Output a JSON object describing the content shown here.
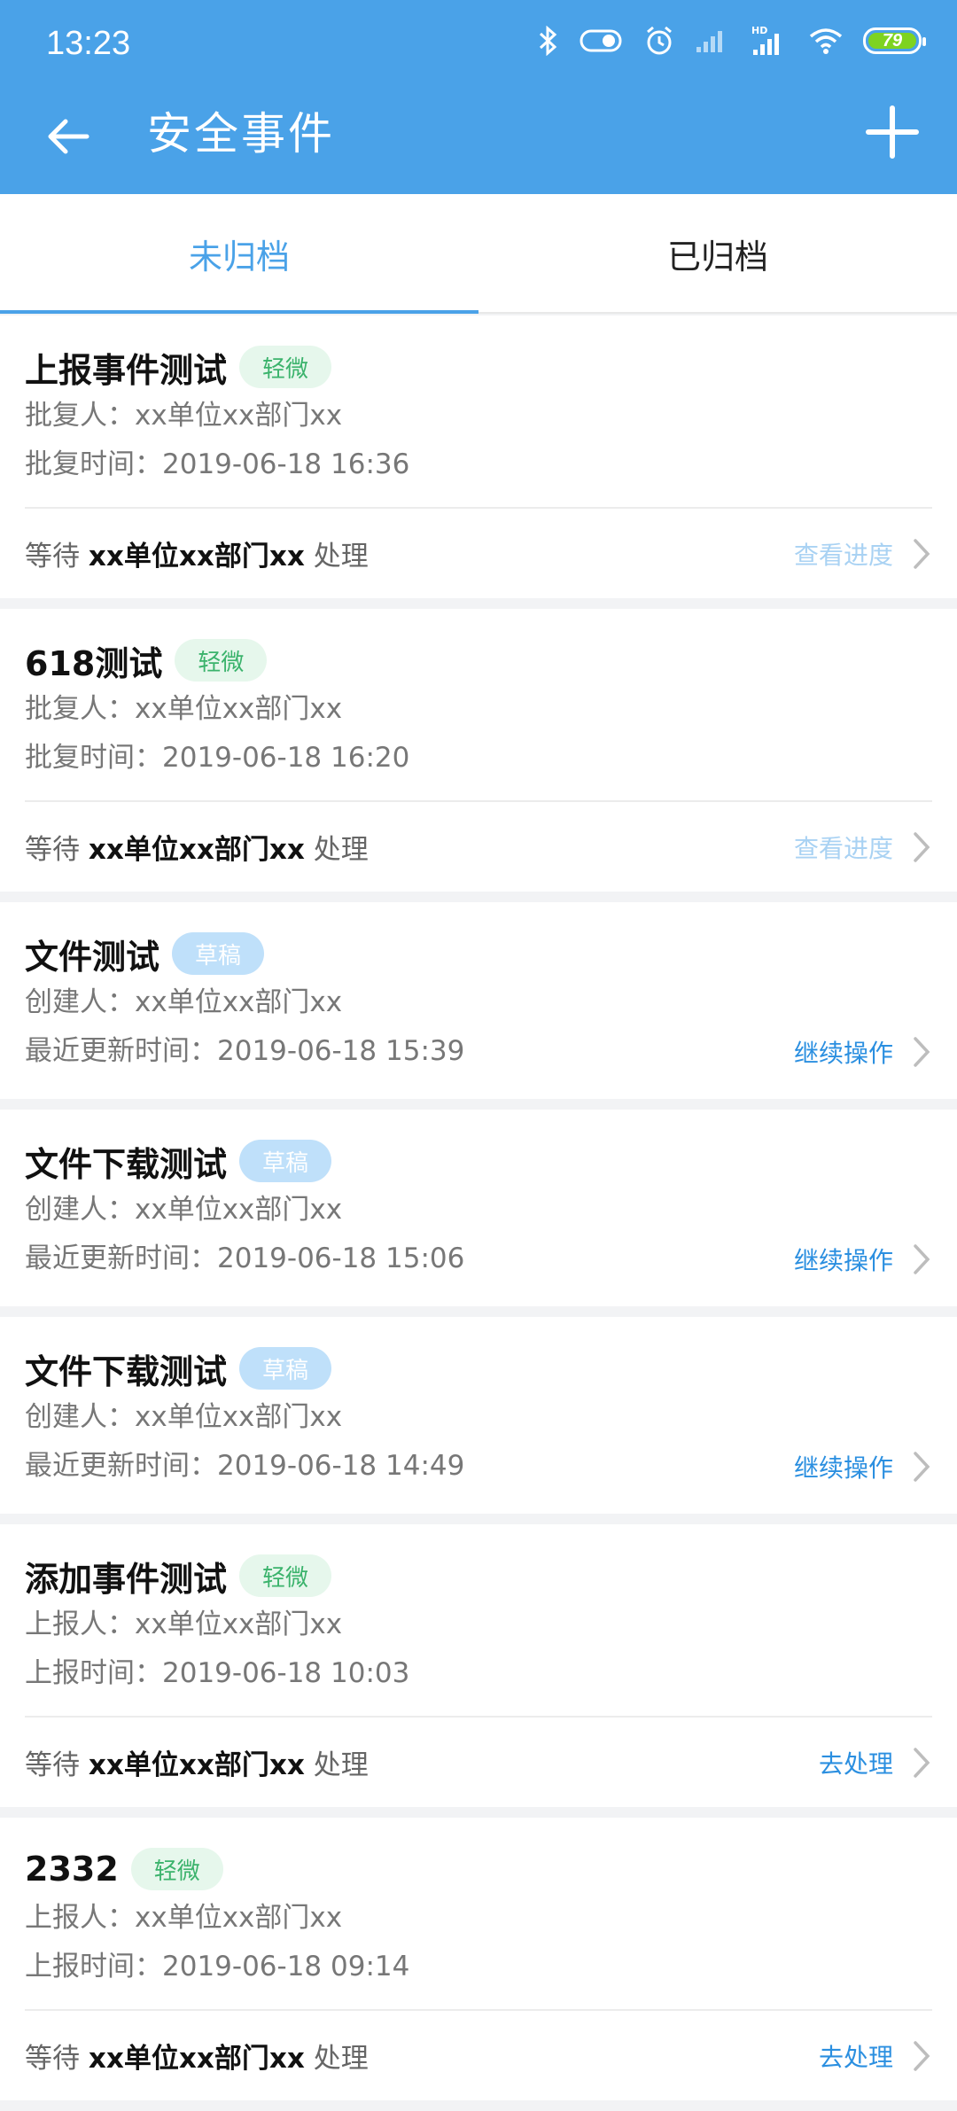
{
  "status_bar": {
    "time": "13:23",
    "battery": "79",
    "icons": [
      "bluetooth-icon",
      "toggle-icon",
      "alarm-icon",
      "signal-icon",
      "hd-signal-icon",
      "wifi-icon",
      "battery-icon"
    ]
  },
  "header": {
    "title": "安全事件",
    "back_icon": "arrow-left-icon",
    "add_icon": "plus-icon"
  },
  "tabs": [
    {
      "label": "未归档",
      "active": true
    },
    {
      "label": "已归档",
      "active": false
    }
  ],
  "colors": {
    "header": "#4aa2e8",
    "accent": "#4aa2e8",
    "light_badge": "#e6f7ec",
    "draft_badge": "#bfe0fa",
    "link": "#2b8fe0",
    "pale_link": "#a9d2f3"
  },
  "events": [
    {
      "title": "上报事件测试",
      "badge": "轻微",
      "meta1": "批复人：xx单位xx部门xx",
      "meta2": "批复时间：2019-06-18 16:36",
      "footer_prefix": "等待 ",
      "footer_bold": "xx单位xx部门xx",
      "footer_suffix": " 处理",
      "action": "查看进度"
    },
    {
      "title": "618测试",
      "badge": "轻微",
      "meta1": "批复人：xx单位xx部门xx",
      "meta2": "批复时间：2019-06-18 16:20",
      "footer_prefix": "等待 ",
      "footer_bold": "xx单位xx部门xx",
      "footer_suffix": " 处理",
      "action": "查看进度"
    },
    {
      "title": "文件测试",
      "badge": "草稿",
      "meta1": "创建人：xx单位xx部门xx",
      "meta2": "最近更新时间：2019-06-18 15:39",
      "action": "继续操作"
    },
    {
      "title": "文件下载测试",
      "badge": "草稿",
      "meta1": "创建人：xx单位xx部门xx",
      "meta2": "最近更新时间：2019-06-18 15:06",
      "action": "继续操作"
    },
    {
      "title": "文件下载测试",
      "badge": "草稿",
      "meta1": "创建人：xx单位xx部门xx",
      "meta2": "最近更新时间：2019-06-18 14:49",
      "action": "继续操作"
    },
    {
      "title": "添加事件测试",
      "badge": "轻微",
      "meta1": "上报人：xx单位xx部门xx",
      "meta2": "上报时间：2019-06-18 10:03",
      "footer_prefix": "等待 ",
      "footer_bold": "xx单位xx部门xx",
      "footer_suffix": " 处理",
      "action": "去处理"
    },
    {
      "title": "2332",
      "badge": "轻微",
      "meta1": "上报人：xx单位xx部门xx",
      "meta2": "上报时间：2019-06-18 09:14",
      "footer_prefix": "等待 ",
      "footer_bold": "xx单位xx部门xx",
      "footer_suffix": " 处理",
      "action": "去处理"
    }
  ]
}
